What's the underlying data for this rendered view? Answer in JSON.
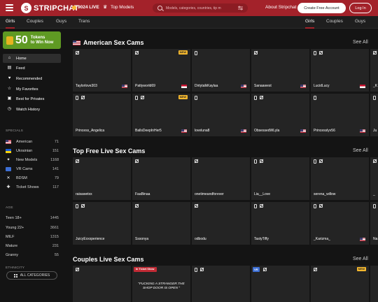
{
  "header": {
    "logo_mark": "S",
    "logo_text": "STRIPCHAT",
    "tokens_label": "9024 LIVE",
    "top_models_label": "Top Models",
    "search_placeholder": "Models, categories, countries, tip m",
    "about_label": "About Stripchat",
    "create_account_label": "Create Free Account",
    "login_label": "Log In"
  },
  "subnav": {
    "left_tabs": [
      "Girls",
      "Couples",
      "Guys",
      "Trans"
    ],
    "right_tabs": [
      "Girls",
      "Couples",
      "Guys"
    ]
  },
  "sidebar": {
    "promo": {
      "number": "50",
      "line1": "Tokens",
      "line2": "to Win Now"
    },
    "nav": [
      "Home",
      "Feed",
      "Recommended",
      "My Favorites",
      "Best for Privates",
      "Watch History"
    ],
    "specials_title": "SPECIALS",
    "specials": [
      {
        "label": "American",
        "count": "71"
      },
      {
        "label": "Ukrainian",
        "count": "151"
      },
      {
        "label": "New Models",
        "count": "1168"
      },
      {
        "label": "VR Cams",
        "count": "141"
      },
      {
        "label": "BDSM",
        "count": "79"
      },
      {
        "label": "Ticket Shows",
        "count": "117"
      }
    ],
    "age_title": "AGE",
    "ages": [
      {
        "label": "Teen 18+",
        "count": "1445"
      },
      {
        "label": "Young 22+",
        "count": "3661"
      },
      {
        "label": "MILF",
        "count": "1315"
      },
      {
        "label": "Mature",
        "count": "231"
      },
      {
        "label": "Granny",
        "count": "55"
      }
    ],
    "ethnicity_title": "ETHNICITY",
    "all_categories_label": "ALL CATEGORIES"
  },
  "sections": [
    {
      "title": "American Sex Cams",
      "see_all": "See All",
      "rows": [
        [
          "Taylorlove303",
          "Pattyworld69",
          "DirtytalkKaylaa",
          "Sanaawest",
          "LucidLucy",
          "_K"
        ],
        [
          "Princess_Angelica",
          "BallsDeepInHer5",
          "loveluna8",
          "ObsessedWLyla",
          "Princesslyv56",
          "Ju"
        ]
      ]
    },
    {
      "title": "Top Free Live Sex Cams",
      "see_all": "See All",
      "rows": [
        [
          "raisawetxx",
          "FaaBinaa",
          "onetimeandforever",
          "Lia__Love",
          "serena_willow",
          "_"
        ],
        [
          "JuicyExxxperience",
          "Sssonya",
          "odbodu",
          "TastyTiffy",
          "_Karizma_",
          "Na"
        ]
      ]
    },
    {
      "title": "Couples Live Sex Cams",
      "see_all": "See All",
      "ticket_label": "In Ticket Show",
      "quote_line1": "\"FUCKING A STRANGER.THE",
      "quote_line2": "SHOP DOOR IS OPEN \""
    }
  ],
  "badges": {
    "new": "NEW",
    "vr": "VR"
  },
  "colors": {
    "brand": "#a3222a",
    "promo_green": "#5f9a23",
    "badge_yellow": "#f5b82e"
  }
}
